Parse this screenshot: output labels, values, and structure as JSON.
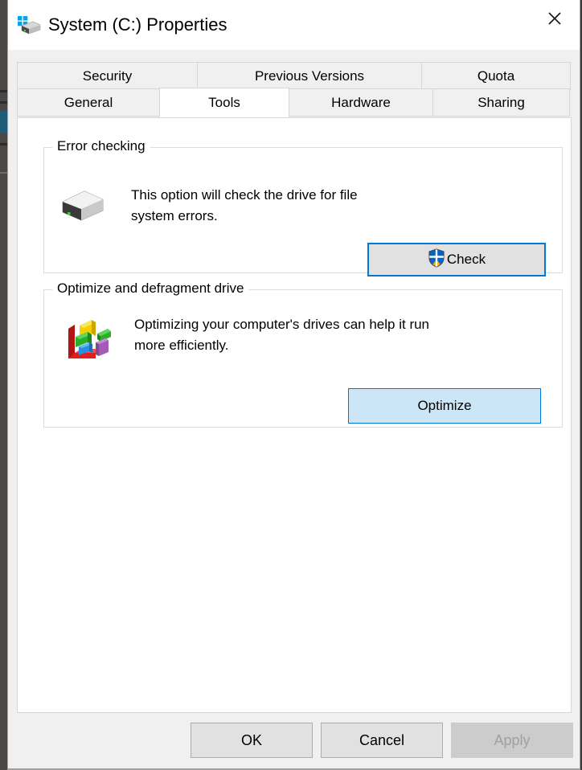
{
  "window": {
    "title": "System (C:) Properties",
    "icon": "drive-windows-icon",
    "close_label": "✕"
  },
  "tabs": {
    "top_row": [
      {
        "label": "Security",
        "selected": false
      },
      {
        "label": "Previous Versions",
        "selected": false
      },
      {
        "label": "Quota",
        "selected": false
      }
    ],
    "bottom_row": [
      {
        "label": "General",
        "selected": false
      },
      {
        "label": "Tools",
        "selected": true
      },
      {
        "label": "Hardware",
        "selected": false
      },
      {
        "label": "Sharing",
        "selected": false
      }
    ]
  },
  "groups": {
    "error_checking": {
      "title": "Error checking",
      "icon": "hard-drive-icon",
      "description": "This option will check the drive for file\nsystem errors.",
      "button": {
        "label": "Check",
        "icon": "uac-shield-icon",
        "state": "focused"
      }
    },
    "optimize": {
      "title": "Optimize and defragment drive",
      "icon": "defragment-blocks-icon",
      "description": "Optimizing your computer's drives can help it run\nmore efficiently.",
      "button": {
        "label": "Optimize",
        "state": "hover"
      }
    }
  },
  "footer": {
    "ok_label": "OK",
    "cancel_label": "Cancel",
    "apply_label": "Apply",
    "apply_disabled": true
  },
  "colors": {
    "accent_blue": "#0078d7",
    "button_face": "#e1e1e1",
    "dialog_face": "#f0f0f0",
    "panel_white": "#ffffff",
    "disabled_text": "#a0a0a0"
  }
}
